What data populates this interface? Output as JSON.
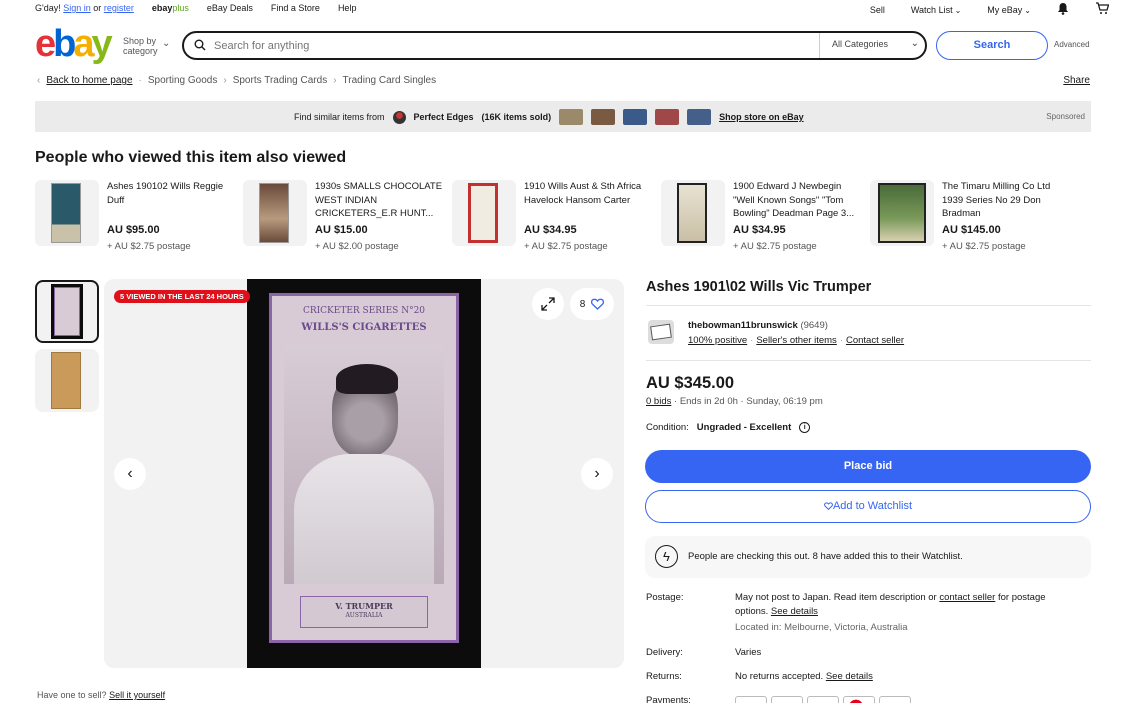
{
  "topbar": {
    "greeting": "G'day!",
    "sign_in": "Sign in",
    "or": "or",
    "register": "register",
    "ebayplus_a": "ebay",
    "ebayplus_b": "plus",
    "deals": "eBay Deals",
    "find_store": "Find a Store",
    "help": "Help",
    "sell": "Sell",
    "watch_list": "Watch List",
    "my_ebay": "My eBay"
  },
  "header": {
    "logo": {
      "e": "e",
      "b": "b",
      "a": "a",
      "y": "y"
    },
    "shop_by_1": "Shop by",
    "shop_by_2": "category",
    "search_placeholder": "Search for anything",
    "category": "All Categories",
    "search_button": "Search",
    "advanced": "Advanced"
  },
  "breadcrumb": {
    "back": "Back to home page",
    "items": [
      "Sporting Goods",
      "Sports Trading Cards",
      "Trading Card Singles"
    ],
    "share": "Share"
  },
  "sponsored_bar": {
    "find_similar": "Find similar items from",
    "seller": "Perfect Edges",
    "sold": "(16K items sold)",
    "shop_store": "Shop store on eBay",
    "sponsored": "Sponsored"
  },
  "also_viewed": {
    "title": "People who viewed this item also viewed",
    "items": [
      {
        "title": "Ashes 190102 Wills Reggie Duff",
        "price": "AU $95.00",
        "postage": "+ AU $2.75 postage"
      },
      {
        "title": "1930s SMALLS CHOCOLATE WEST INDIAN CRICKETERS_E.R HUNT...",
        "price": "AU $15.00",
        "postage": "+ AU $2.00 postage"
      },
      {
        "title": "1910 Wills Aust & Sth Africa Havelock Hansom Carter",
        "price": "AU $34.95",
        "postage": "+ AU $2.75 postage"
      },
      {
        "title": "1900 Edward J Newbegin \"Well Known Songs\" \"Tom Bowling\" Deadman Page 3...",
        "price": "AU $34.95",
        "postage": "+ AU $2.75 postage"
      },
      {
        "title": "The Timaru Milling Co Ltd 1939 Series No 29 Don Bradman",
        "price": "AU $145.00",
        "postage": "+ AU $2.75 postage"
      }
    ]
  },
  "gallery": {
    "badge": "5 VIEWED IN THE LAST 24 HOURS",
    "watch_count": "8",
    "card_top": "CRICKETER SERIES N°20",
    "card_brand": "WILLS'S CIGARETTES",
    "card_name": "V. TRUMPER",
    "card_country": "AUSTRALIA"
  },
  "sell_it": {
    "prompt": "Have one to sell?",
    "link": "Sell it yourself"
  },
  "item": {
    "title": "Ashes 1901\\02 Wills Vic Trumper",
    "seller_name": "thebowman11brunswick",
    "seller_feedback": "(9649)",
    "positive": "100% positive",
    "other_items": "Seller's other items",
    "contact": "Contact seller",
    "price": "AU $345.00",
    "bids": "0 bids",
    "ends": "Ends in 2d 0h · Sunday, 06:19 pm",
    "condition_label": "Condition:",
    "condition_value": "Ungraded - Excellent",
    "place_bid": "Place bid",
    "add_watchlist": "Add to Watchlist",
    "checking": "People are checking this out. 8 have added this to their Watchlist.",
    "postage_label": "Postage:",
    "postage_text_1": "May not post to Japan. Read item description or",
    "postage_contact": "contact seller",
    "postage_text_2": "for postage options.",
    "see_details": "See details",
    "located": "Located in: Melbourne, Victoria, Australia",
    "delivery_label": "Delivery:",
    "delivery_value": "Varies",
    "returns_label": "Returns:",
    "returns_value": "No returns accepted.",
    "payments_label": "Payments:"
  }
}
